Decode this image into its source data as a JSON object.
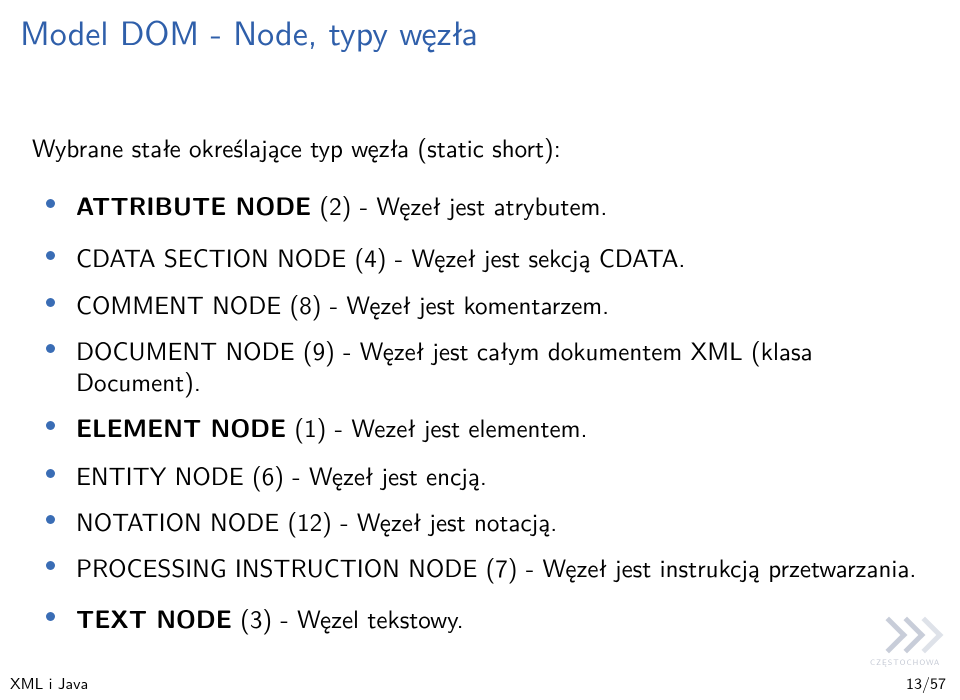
{
  "title": "Model DOM - Node, typy węzła",
  "subtitle": "Wybrane stałe określające typ węzła (static short):",
  "items": [
    {
      "bold": "ATTRIBUTE NODE",
      "rest": " (2) - Węzeł jest atrybutem."
    },
    {
      "plain": "CDATA SECTION NODE (4) - Węzeł jest sekcją CDATA."
    },
    {
      "plain": "COMMENT NODE (8) - Węzeł jest komentarzem."
    },
    {
      "plain": "DOCUMENT NODE (9) - Węzeł jest całym dokumentem XML (klasa Document)."
    },
    {
      "bold": "ELEMENT NODE",
      "rest": " (1) - Wezeł jest elementem."
    },
    {
      "plain": "ENTITY NODE (6) - Węzeł jest encją."
    },
    {
      "plain": "NOTATION NODE (12) - Węzeł jest notacją."
    },
    {
      "plain": "PROCESSING INSTRUCTION NODE (7) - Węzeł jest instrukcją przetwarzania."
    },
    {
      "bold": "TEXT NODE",
      "rest": " (3) - Węzel tekstowy."
    }
  ],
  "footer": {
    "left": "XML i Java",
    "right": "13/57"
  },
  "logo_text": "CZĘSTOCHOWA"
}
